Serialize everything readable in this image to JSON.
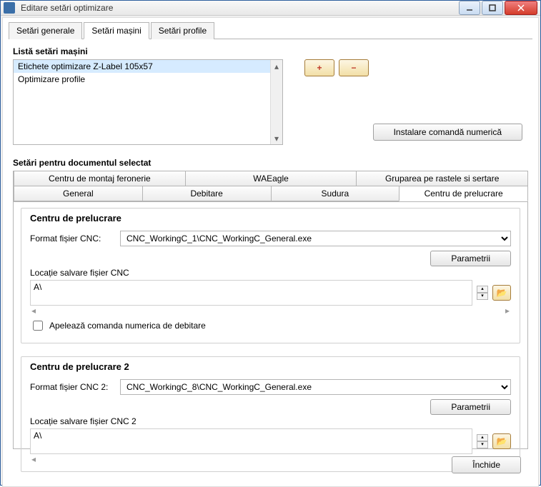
{
  "window": {
    "title": "Editare setări optimizare"
  },
  "tabs": {
    "general": "Setări generale",
    "machines": "Setări mașini",
    "profiles": "Setări profile"
  },
  "list": {
    "heading": "Listă setări mașini",
    "items": [
      "Etichete optimizare Z-Label 105x57",
      "Optimizare profile"
    ]
  },
  "install_btn": "Instalare comandă numerică",
  "section2_heading": "Setări pentru documentul selectat",
  "subtabs": {
    "row1": [
      "Centru de montaj feronerie",
      "WAEagle",
      "Gruparea pe rastele si sertare"
    ],
    "row2": [
      "General",
      "Debitare",
      "Sudura",
      "Centru de prelucrare"
    ]
  },
  "group1": {
    "title": "Centru de prelucrare",
    "format_label": "Format fișier CNC:",
    "format_value": "CNC_WorkingC_1\\CNC_WorkingC_General.exe",
    "param_btn": "Parametrii",
    "loc_label": "Locație salvare fișier CNC",
    "loc_value": "A\\",
    "checkbox_label": "Apelează comanda numerica de debitare"
  },
  "group2": {
    "title": "Centru de prelucrare 2",
    "format_label": "Format fișier CNC 2:",
    "format_value": "CNC_WorkingC_8\\CNC_WorkingC_General.exe",
    "param_btn": "Parametrii",
    "loc_label": "Locație salvare fișier CNC 2",
    "loc_value": "A\\"
  },
  "close_btn": "Închide",
  "icons": {
    "plus": "+",
    "minus": "−",
    "folder": "📂",
    "up": "▴",
    "down": "▾",
    "left": "◂",
    "right": "▸"
  }
}
